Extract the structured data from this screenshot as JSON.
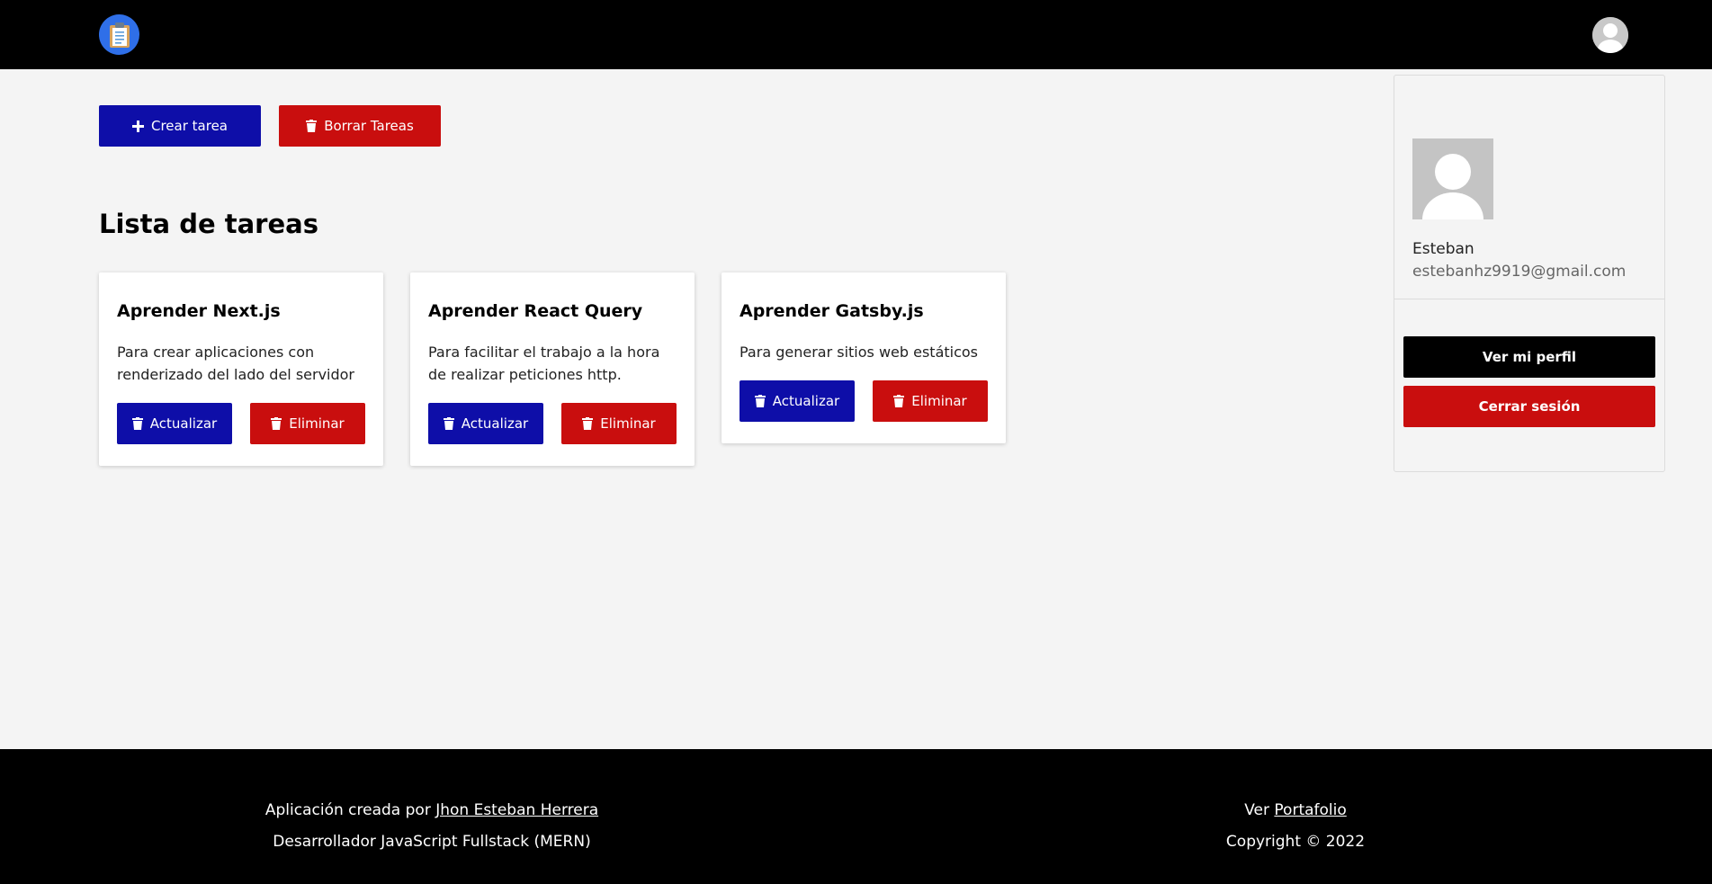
{
  "header": {
    "logo_icon": "clipboard-icon",
    "avatar_icon": "user-avatar-icon"
  },
  "actions": {
    "create_label": "Crear tarea",
    "create_icon": "plus-icon",
    "clear_label": "Borrar Tareas",
    "clear_icon": "trash-icon"
  },
  "main": {
    "list_title": "Lista de tareas",
    "tasks": [
      {
        "title": "Aprender Next.js",
        "description": "Para crear aplicaciones con renderizado del lado del servidor",
        "update_label": "Actualizar",
        "delete_label": "Eliminar"
      },
      {
        "title": "Aprender React Query",
        "description": "Para facilitar el trabajo a la hora de realizar peticiones http.",
        "update_label": "Actualizar",
        "delete_label": "Eliminar"
      },
      {
        "title": "Aprender Gatsby.js",
        "description": "Para generar sitios web estáticos",
        "update_label": "Actualizar",
        "delete_label": "Eliminar"
      }
    ]
  },
  "profile": {
    "name": "Esteban",
    "email": "estebanhz9919@gmail.com",
    "view_profile_label": "Ver mi perfil",
    "logout_label": "Cerrar sesión"
  },
  "footer": {
    "created_by_prefix": "Aplicación creada por",
    "author_link": "Jhon Esteban Herrera",
    "role": "Desarrollador JavaScript Fullstack (MERN)",
    "portfolio_prefix": "Ver",
    "portfolio_link": "Portafolio",
    "copyright": "Copyright © 2022"
  },
  "colors": {
    "primary_blue": "#0e0ea8",
    "danger_red": "#c90e0e",
    "header_bg": "#000000",
    "logo_bg": "#2f6fe8"
  }
}
